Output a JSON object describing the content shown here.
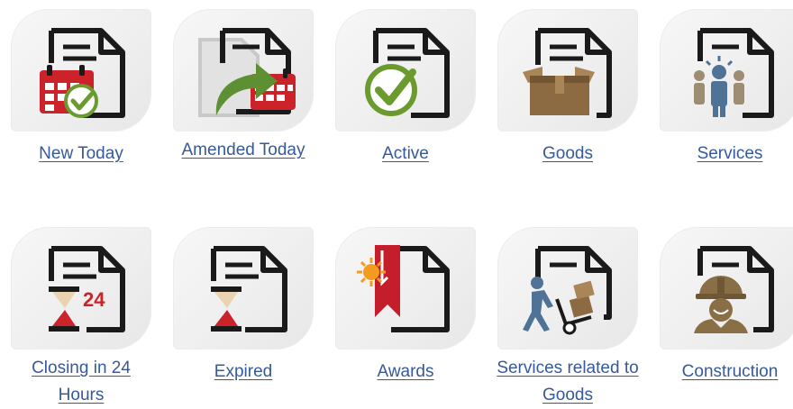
{
  "tiles": [
    {
      "label": "New Today",
      "icon": "new-today-icon"
    },
    {
      "label": "Amended Today",
      "icon": "amended-today-icon"
    },
    {
      "label": "Active",
      "icon": "active-icon"
    },
    {
      "label": "Goods",
      "icon": "goods-icon"
    },
    {
      "label": "Services",
      "icon": "services-icon"
    },
    {
      "label": "Closing in 24 Hours",
      "icon": "closing-24-hours-icon",
      "badge": "24"
    },
    {
      "label": "Expired",
      "icon": "expired-icon"
    },
    {
      "label": "Awards",
      "icon": "awards-icon"
    },
    {
      "label": "Services related to Goods",
      "icon": "services-related-to-goods-icon"
    },
    {
      "label": "Construction",
      "icon": "construction-icon"
    }
  ],
  "colors": {
    "link": "#35599a",
    "document": "#1a1a1a",
    "calendar_red": "#cc2229",
    "check_green": "#6b9b2f",
    "box_brown": "#8c6b43",
    "person_blue": "#4f7396",
    "award_red": "#c41e2d",
    "award_sun": "#f39c1f",
    "worker_brown": "#8a6e46"
  }
}
